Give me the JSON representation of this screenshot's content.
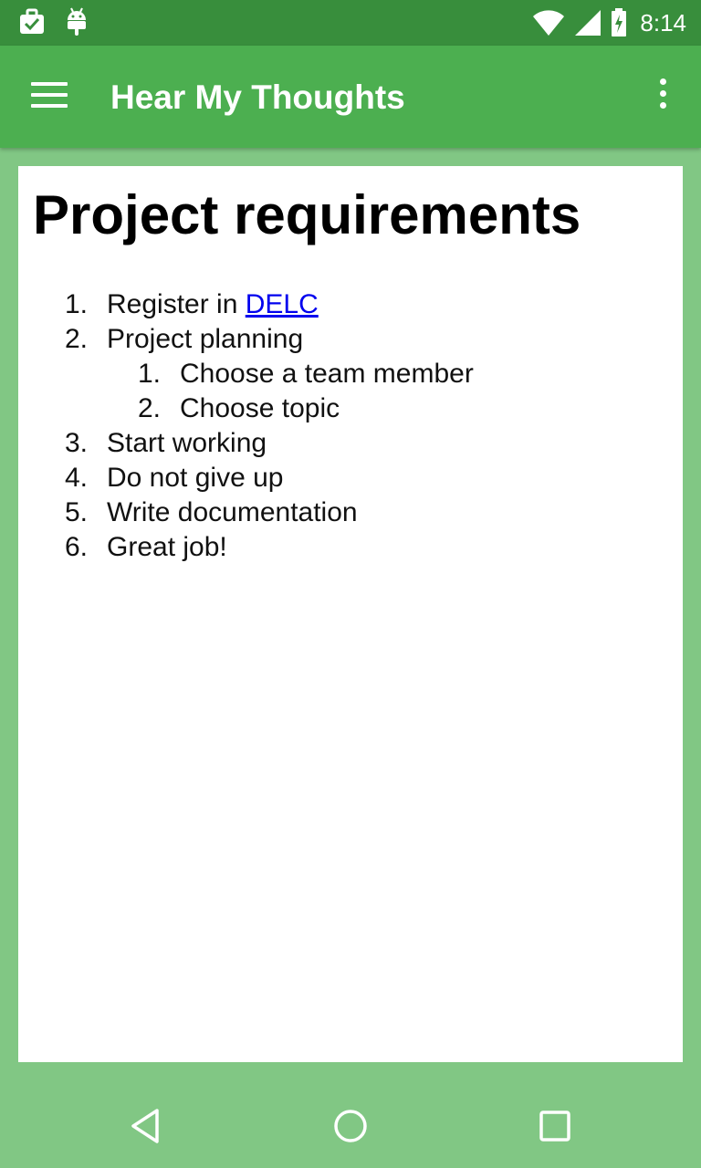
{
  "status_bar": {
    "time": "8:14",
    "icons": [
      "briefcase-check-icon",
      "android-icon",
      "wifi-icon",
      "cell-signal-icon",
      "battery-charging-icon"
    ]
  },
  "app_bar": {
    "title": "Hear My Thoughts",
    "menu_icon": "hamburger-menu-icon",
    "overflow_icon": "more-vert-icon"
  },
  "document": {
    "title": "Project requirements",
    "items": [
      {
        "number": "1.",
        "text": "Register in ",
        "link": "DELC"
      },
      {
        "number": "2.",
        "text": "Project planning",
        "subitems": [
          {
            "number": "1.",
            "text": "Choose a team member"
          },
          {
            "number": "2.",
            "text": "Choose topic"
          }
        ]
      },
      {
        "number": "3.",
        "text": "Start working"
      },
      {
        "number": "4.",
        "text": "Do not give up"
      },
      {
        "number": "5.",
        "text": "Write documentation"
      },
      {
        "number": "6.",
        "text": "Great job!"
      }
    ]
  },
  "nav_bar": {
    "buttons": [
      "back-icon",
      "home-icon",
      "recents-icon"
    ]
  },
  "colors": {
    "status_bar": "#388E3C",
    "app_bar": "#4CAF50",
    "background": "#81C784",
    "card": "#FFFFFF",
    "link": "#0000EE"
  }
}
